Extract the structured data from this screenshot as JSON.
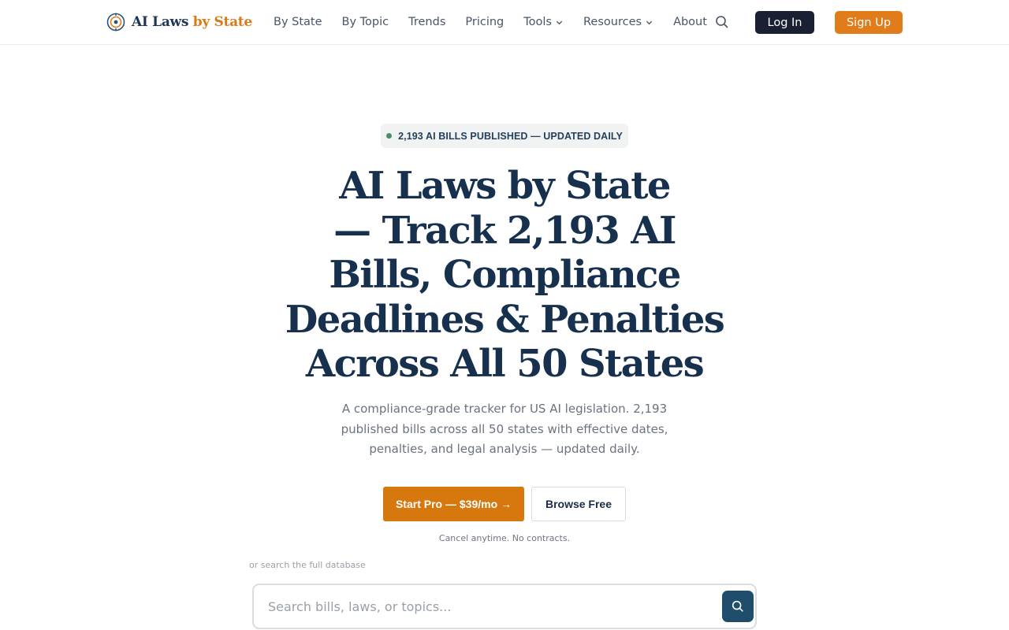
{
  "header": {
    "logo": {
      "part1": "AI Laws",
      "part2": "by State",
      "icon": "target-scale-icon"
    },
    "nav": [
      {
        "label": "By State"
      },
      {
        "label": "By Topic"
      },
      {
        "label": "Trends"
      },
      {
        "label": "Pricing"
      },
      {
        "label": "Tools",
        "dropdown": true
      },
      {
        "label": "Resources",
        "dropdown": true
      },
      {
        "label": "About"
      }
    ],
    "search_icon": "search-icon",
    "login_label": "Log In",
    "signup_label": "Sign Up"
  },
  "hero": {
    "badge": "2,193 AI BILLS PUBLISHED — UPDATED DAILY",
    "title_lines": [
      "AI Laws by State",
      "— Track 2,193 AI",
      "Bills, Compliance",
      "Deadlines & Penalties",
      "Across All 50 States"
    ],
    "subtitle": "A compliance-grade tracker for US AI legislation. 2,193 published bills across all 50 states with effective dates, penalties, and legal analysis — updated daily.",
    "cta_primary": "Start Pro — $39/mo →",
    "cta_secondary": "Browse Free",
    "cta_note": "Cancel anytime. No contracts."
  },
  "search": {
    "label": "or search the full database",
    "placeholder": "Search bills, laws, or topics...",
    "value": ""
  },
  "colors": {
    "brand_navy": "#16304d",
    "brand_orange": "#e07d1a",
    "dark_button": "#1a2033",
    "search_button": "#1f4d6b",
    "badge_dot": "#4c8c6c"
  }
}
